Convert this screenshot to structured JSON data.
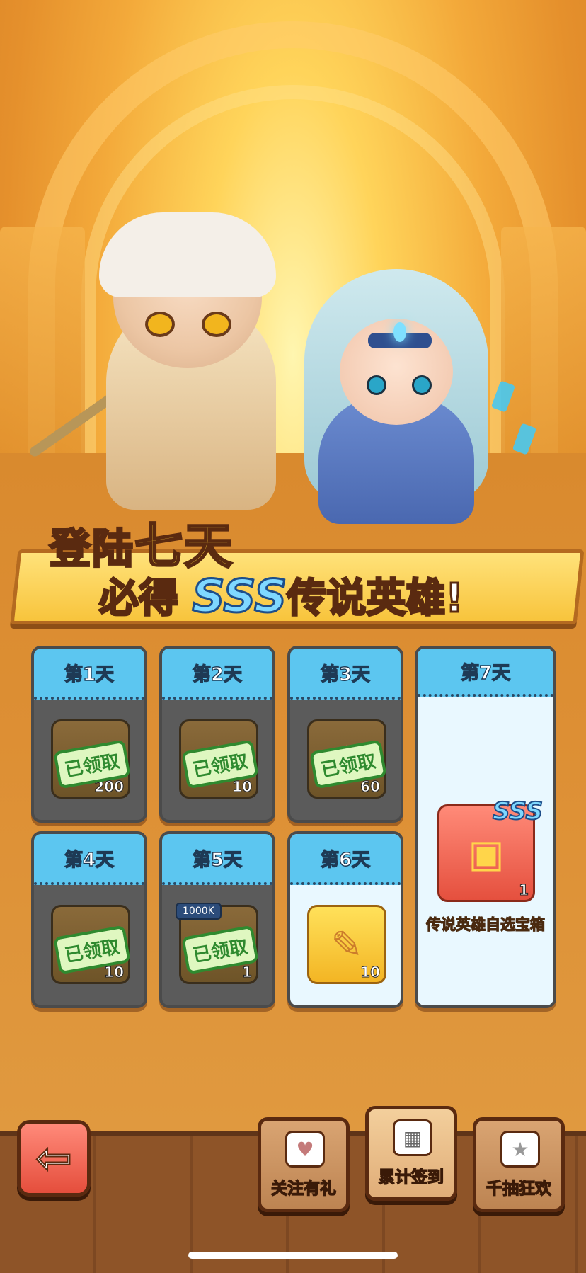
{
  "banner": {
    "line1_part1": "登陆",
    "line1_highlight": "七天",
    "line2_part1": "必得",
    "line2_sss": "SSS",
    "line2_highlight": "传说",
    "line2_part2": "英雄!"
  },
  "days": [
    {
      "label": "第1天",
      "quantity": "200",
      "claimed": true,
      "claimed_label": "已领取"
    },
    {
      "label": "第2天",
      "quantity": "10",
      "claimed": true,
      "claimed_label": "已领取"
    },
    {
      "label": "第3天",
      "quantity": "60",
      "claimed": true,
      "claimed_label": "已领取"
    },
    {
      "label": "第4天",
      "quantity": "10",
      "claimed": true,
      "claimed_label": "已领取"
    },
    {
      "label": "第5天",
      "quantity": "1",
      "tag": "1000K",
      "claimed": true,
      "claimed_label": "已领取"
    },
    {
      "label": "第6天",
      "quantity": "10",
      "claimed": false
    },
    {
      "label": "第7天",
      "quantity": "1",
      "badge": "SSS",
      "item_name": "传说英雄自选宝箱",
      "claimed": false
    }
  ],
  "nav": {
    "follow_label": "关注有礼",
    "checkin_label": "累计签到",
    "draw_label": "千抽狂欢"
  },
  "colors": {
    "day_header": "#5cc6f0",
    "claimed_stamp": "#2f8a2f",
    "back_button": "#e54e3c"
  }
}
